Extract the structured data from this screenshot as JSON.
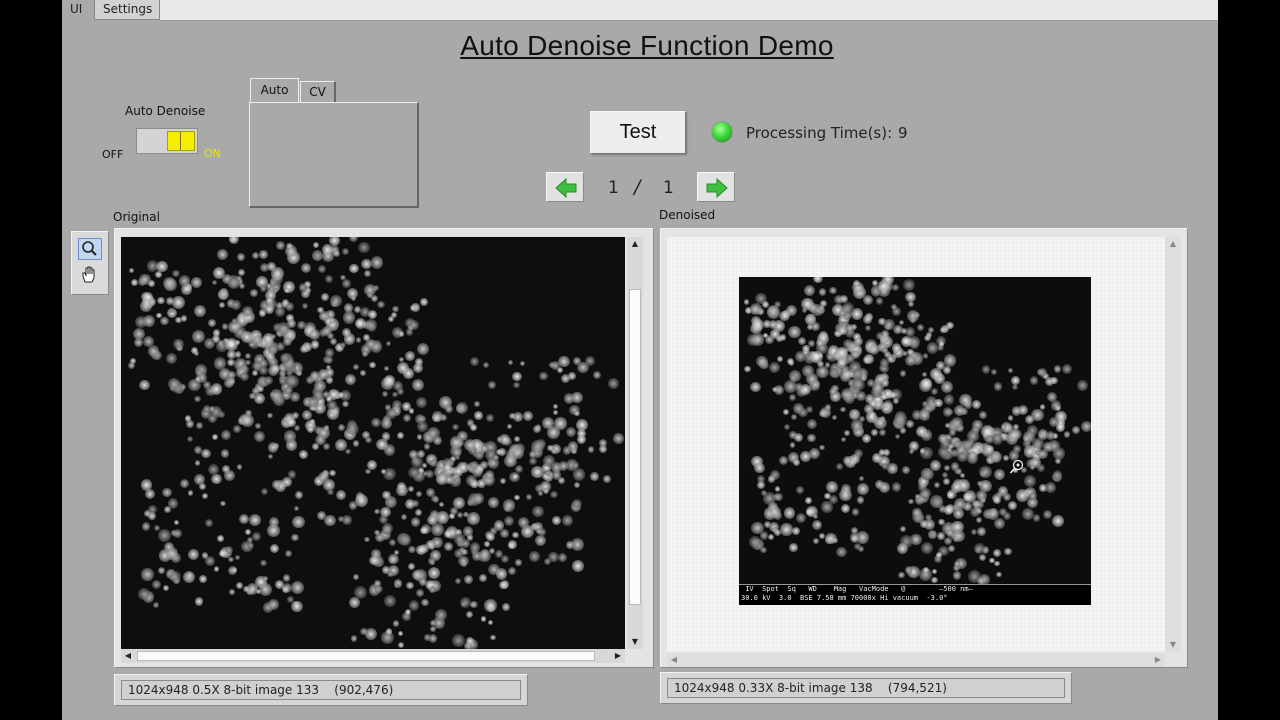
{
  "tabs": {
    "ui": "UI",
    "settings": "Settings"
  },
  "title": "Auto Denoise Function Demo",
  "auto_denoise": {
    "label": "Auto Denoise",
    "off_label": "OFF",
    "on_label": "ON",
    "state": "on"
  },
  "mode_tabs": [
    "Auto",
    "CV"
  ],
  "test_button": "Test",
  "processing": {
    "label": "Processing Time(s):",
    "value": "9",
    "indicator_color": "#3dd83a"
  },
  "pager": {
    "current": "1",
    "separator": "/",
    "total": "1"
  },
  "original": {
    "label": "Original",
    "info": "1024x948 0.5X 8-bit image 133    (902,476)"
  },
  "denoised": {
    "label": "Denoised",
    "info": "1024x948 0.33X 8-bit image 138    (794,521)",
    "sem_bar_line1": " IV  Spot  Sq   WD    Mag   VacMode   @        —500 nm—",
    "sem_bar_line2": "30.0 kV  3.0  BSE 7.58 mm 70000x Hi vacuum  -3.0°"
  },
  "icons": {
    "zoom": "magnifier-icon",
    "pan": "hand-icon",
    "prev": "left-arrow-icon",
    "next": "right-arrow-icon"
  },
  "colors": {
    "panel": "#a9a9a9",
    "toggle_on": "#f5ee00",
    "arrow_green": "#3fbf3f"
  }
}
